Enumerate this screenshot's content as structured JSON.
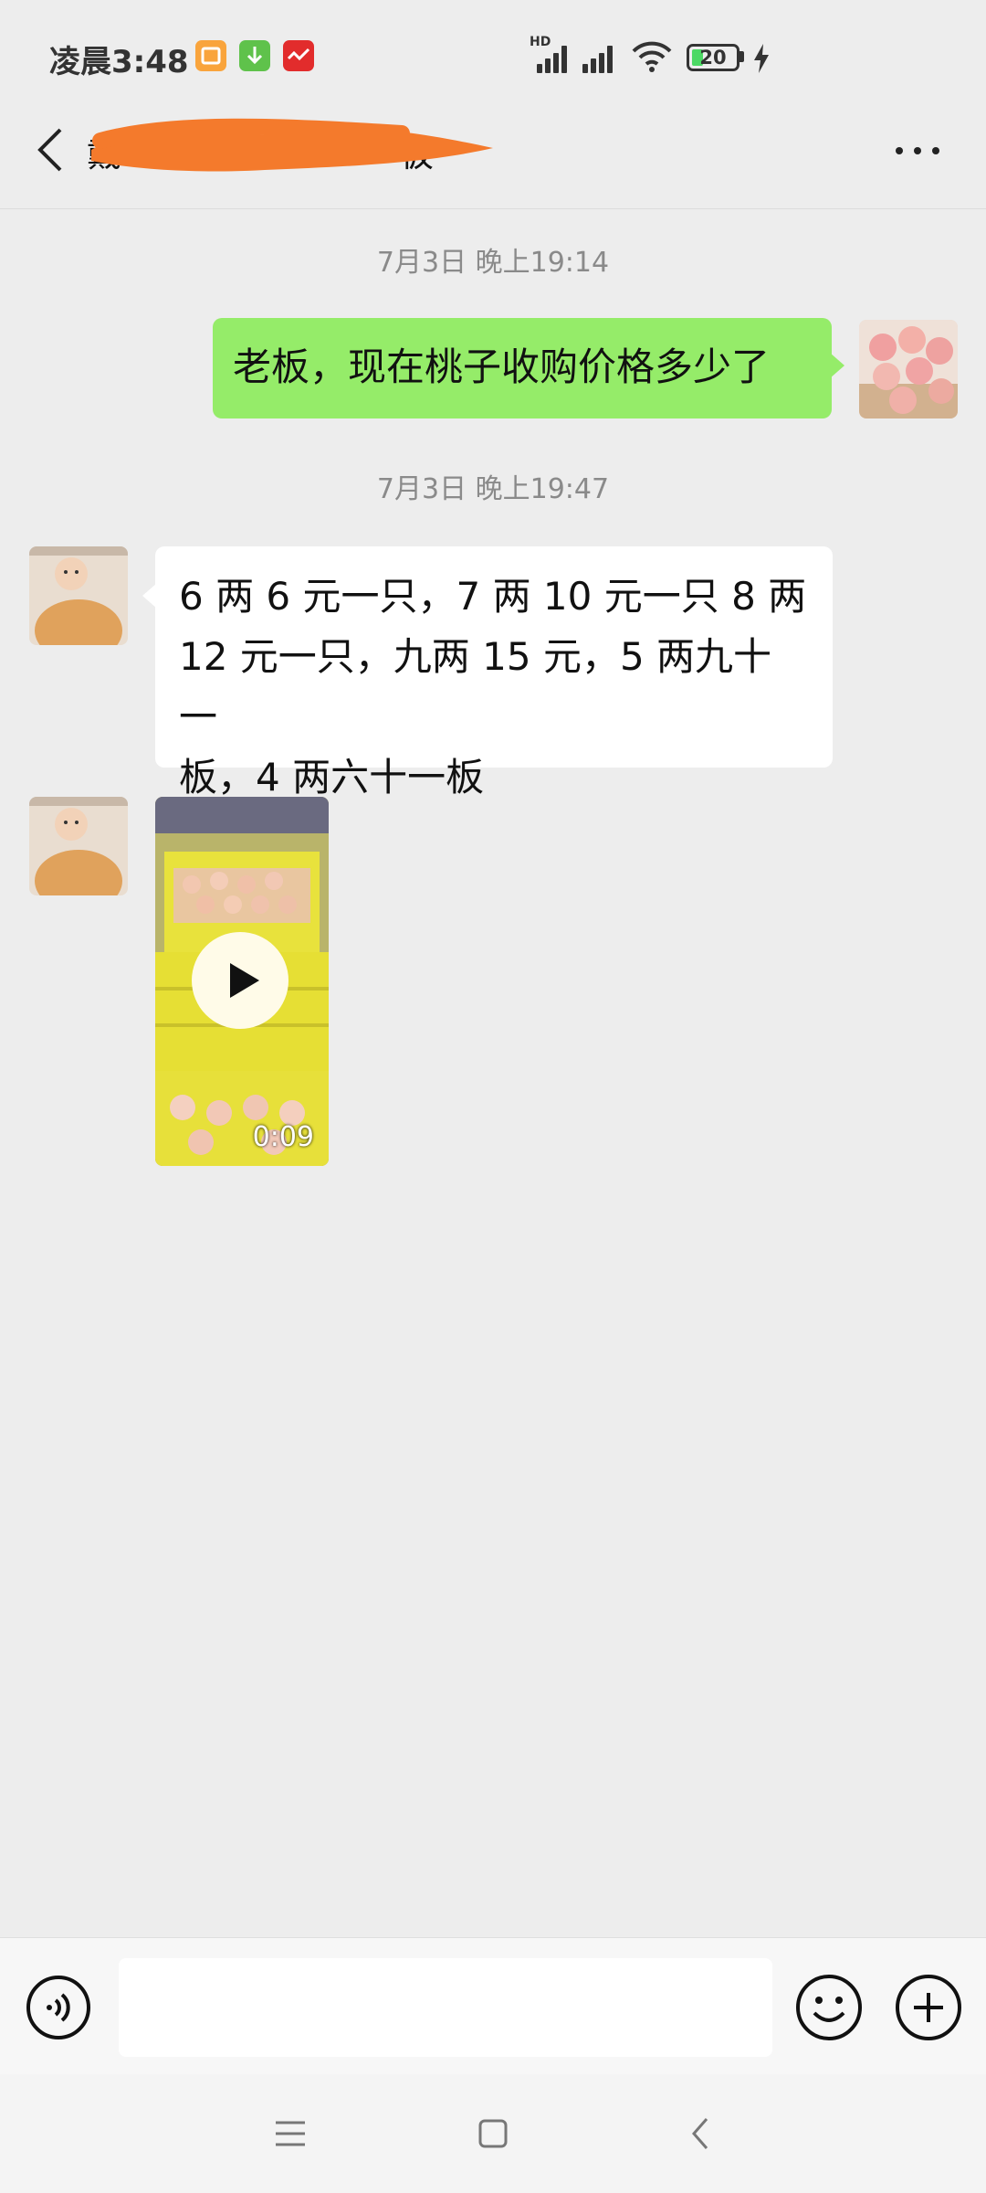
{
  "status_bar": {
    "time": "凌晨3:48",
    "network_label": "HD",
    "battery": "20"
  },
  "header": {
    "title": "戴　　　　　　　　板"
  },
  "messages": [
    {
      "type": "timestamp",
      "text": "7月3日 晚上19:14"
    },
    {
      "type": "text",
      "direction": "outgoing",
      "text": "老板，现在桃子收购价格多少了"
    },
    {
      "type": "timestamp",
      "text": "7月3日 晚上19:47"
    },
    {
      "type": "text",
      "direction": "incoming",
      "lines": [
        "6 两 6 元一只，7 两 10 元一只 8 两",
        "12 元一只，九两 15 元，5 两九十一",
        "板，4 两六十一板"
      ]
    },
    {
      "type": "video",
      "direction": "incoming",
      "duration": "0:09"
    }
  ],
  "colors": {
    "background": "#ededed",
    "outgoing_bubble": "#95ec69",
    "incoming_bubble": "#ffffff",
    "redaction": "#f47a2c"
  },
  "icons": [
    "back-arrow-icon",
    "more-icon",
    "voice-icon",
    "emoji-icon",
    "plus-icon",
    "play-icon",
    "menu-nav-icon",
    "home-nav-icon",
    "back-nav-icon"
  ]
}
